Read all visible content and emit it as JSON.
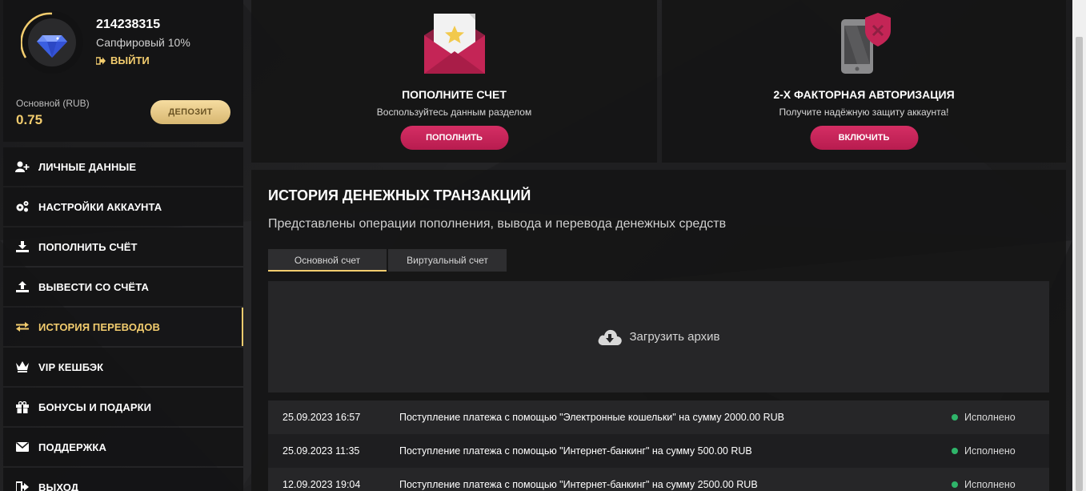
{
  "profile": {
    "user_id": "214238315",
    "level": "Сапфировый 10%",
    "logout_label": "ВЫЙТИ",
    "balance_label": "Основной (RUB)",
    "balance_value": "0.75",
    "deposit_label": "ДЕПОЗИТ"
  },
  "nav": {
    "items": [
      {
        "label": "ЛИЧНЫЕ ДАННЫЕ",
        "icon": "user-plus-icon"
      },
      {
        "label": "НАСТРОЙКИ АККАУНТА",
        "icon": "gears-icon"
      },
      {
        "label": "ПОПОЛНИТЬ СЧЁТ",
        "icon": "download-icon"
      },
      {
        "label": "ВЫВЕСТИ СО СЧЁТА",
        "icon": "upload-icon"
      },
      {
        "label": "ИСТОРИЯ ПЕРЕВОДОВ",
        "icon": "transfer-arrows-icon",
        "active": true
      },
      {
        "label": "VIP КЕШБЭК",
        "icon": "crown-icon"
      },
      {
        "label": "БОНУСЫ И ПОДАРКИ",
        "icon": "gift-icon"
      },
      {
        "label": "ПОДДЕРЖКА",
        "icon": "envelope-icon"
      },
      {
        "label": "ВЫХОД",
        "icon": "logout-icon"
      }
    ]
  },
  "cards": {
    "deposit": {
      "title": "ПОПОЛНИТЕ СЧЕТ",
      "subtitle": "Воспользуйтесь данным разделом",
      "button": "ПОПОЛНИТЬ"
    },
    "twofa": {
      "title": "2-Х ФАКТОРНАЯ АВТОРИЗАЦИЯ",
      "subtitle": "Получите надёжную защиту аккаунта!",
      "button": "ВКЛЮЧИТЬ"
    }
  },
  "history": {
    "title": "ИСТОРИЯ ДЕНЕЖНЫХ ТРАНЗАКЦИЙ",
    "subtitle": "Представлены операции пополнения, вывода и перевода денежных средств",
    "tabs": [
      "Основной счет",
      "Виртуальный счет"
    ],
    "archive_label": "Загрузить архив",
    "rows": [
      {
        "date": "25.09.2023 16:57",
        "description": "Поступление платежа с помощью \"Электронные кошельки\" на сумму 2000.00 RUB",
        "status": "Исполнено"
      },
      {
        "date": "25.09.2023 11:35",
        "description": "Поступление платежа с помощью \"Интернет-банкинг\" на сумму 500.00 RUB",
        "status": "Исполнено"
      },
      {
        "date": "12.09.2023 19:04",
        "description": "Поступление платежа с помощью \"Интернет-банкинг\" на сумму 2500.00 RUB",
        "status": "Исполнено"
      }
    ]
  },
  "colors": {
    "accent_gold": "#f2cc6e",
    "accent_pink": "#c8245a",
    "status_green": "#2fb56a"
  }
}
